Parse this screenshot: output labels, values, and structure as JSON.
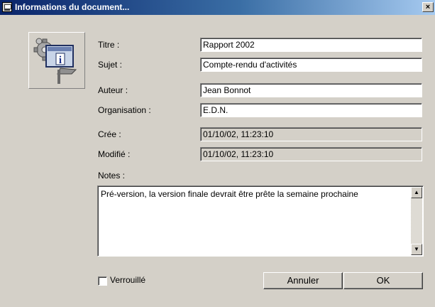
{
  "window": {
    "title": "Informations du document...",
    "close_glyph": "×"
  },
  "icon": {
    "name": "document-info-icon"
  },
  "fields": {
    "titre": {
      "label": "Titre :",
      "value": "Rapport 2002"
    },
    "sujet": {
      "label": "Sujet :",
      "value": "Compte-rendu d'activités"
    },
    "auteur": {
      "label": "Auteur :",
      "value": "Jean Bonnot"
    },
    "organisation": {
      "label": "Organisation :",
      "value": "E.D.N."
    },
    "cree": {
      "label": "Crée :",
      "value": "01/10/02, 11:23:10"
    },
    "modifie": {
      "label": "Modifié :",
      "value": "01/10/02, 11:23:10"
    }
  },
  "notes": {
    "label": "Notes :",
    "value": "Pré-version, la version finale devrait être prête la semaine prochaine"
  },
  "lock": {
    "label": "Verrouillé",
    "checked": false
  },
  "buttons": {
    "cancel": "Annuler",
    "ok": "OK"
  }
}
